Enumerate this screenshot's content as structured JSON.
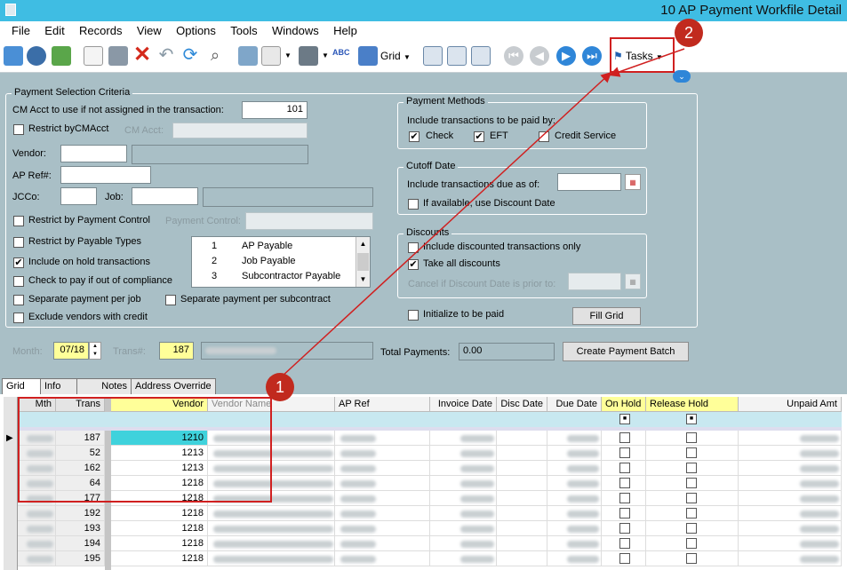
{
  "window": {
    "title": "10 AP Payment Workfile Detail"
  },
  "menu": [
    "File",
    "Edit",
    "Records",
    "View",
    "Options",
    "Tools",
    "Windows",
    "Help"
  ],
  "toolbar": {
    "grid_label": "Grid",
    "tasks_label": "Tasks"
  },
  "annotations": {
    "marker1": "1",
    "marker2": "2"
  },
  "criteria": {
    "group_title": "Payment Selection Criteria",
    "cm_acct_label": "CM Acct to use if not assigned in the transaction:",
    "cm_acct_value": "101",
    "restrict_cmacct_label": "Restrict byCMAcct",
    "cm_acct_short_label": "CM Acct:",
    "vendor_label": "Vendor:",
    "ap_ref_label": "AP Ref#:",
    "jcco_label": "JCCo:",
    "job_label": "Job:",
    "restrict_payment_control_label": "Restrict by Payment Control",
    "payment_control_label": "Payment Control:",
    "restrict_payable_types_label": "Restrict by Payable Types",
    "include_on_hold_label": "Include on hold transactions",
    "check_to_pay_label": "Check to pay if out of compliance",
    "separate_job_label": "Separate payment per job",
    "separate_subcontract_label": "Separate payment per subcontract",
    "exclude_vendors_label": "Exclude vendors with credit",
    "payable_types": [
      {
        "num": "1",
        "name": "AP Payable"
      },
      {
        "num": "2",
        "name": "Job Payable"
      },
      {
        "num": "3",
        "name": "Subcontractor Payable"
      }
    ]
  },
  "methods": {
    "group_title": "Payment Methods",
    "include_label": "Include transactions to be paid by:",
    "check_label": "Check",
    "eft_label": "EFT",
    "credit_label": "Credit Service"
  },
  "cutoff": {
    "group_title": "Cutoff Date",
    "due_label": "Include transactions due as of:",
    "discount_date_label": "If available, use Discount Date"
  },
  "discounts": {
    "group_title": "Discounts",
    "include_discounted_label": "Include discounted transactions only",
    "take_all_label": "Take all discounts",
    "cancel_label": "Cancel if Discount Date is prior to:"
  },
  "initialize_label": "Initialize to be paid",
  "fill_grid_label": "Fill Grid",
  "batch": {
    "month_label": "Month:",
    "month_value": "07/18",
    "trans_label": "Trans#:",
    "trans_value": "187",
    "total_label": "Total Payments:",
    "total_value": "0.00",
    "create_label": "Create Payment Batch"
  },
  "tabs": [
    "Grid",
    "Info",
    "Notes",
    "Address Override"
  ],
  "grid": {
    "columns": [
      "Mth",
      "Trans",
      "Vendor",
      "Vendor Name",
      "AP Ref",
      "Invoice Date",
      "Disc Date",
      "Due Date",
      "On Hold",
      "Release Hold Code",
      "Unpaid Amt"
    ],
    "rows": [
      {
        "trans": "187",
        "vendor": "1210"
      },
      {
        "trans": "52",
        "vendor": "1213"
      },
      {
        "trans": "162",
        "vendor": "1213"
      },
      {
        "trans": "64",
        "vendor": "1218"
      },
      {
        "trans": "177",
        "vendor": "1218"
      },
      {
        "trans": "192",
        "vendor": "1218"
      },
      {
        "trans": "193",
        "vendor": "1218"
      },
      {
        "trans": "194",
        "vendor": "1218"
      },
      {
        "trans": "195",
        "vendor": "1218"
      }
    ]
  }
}
